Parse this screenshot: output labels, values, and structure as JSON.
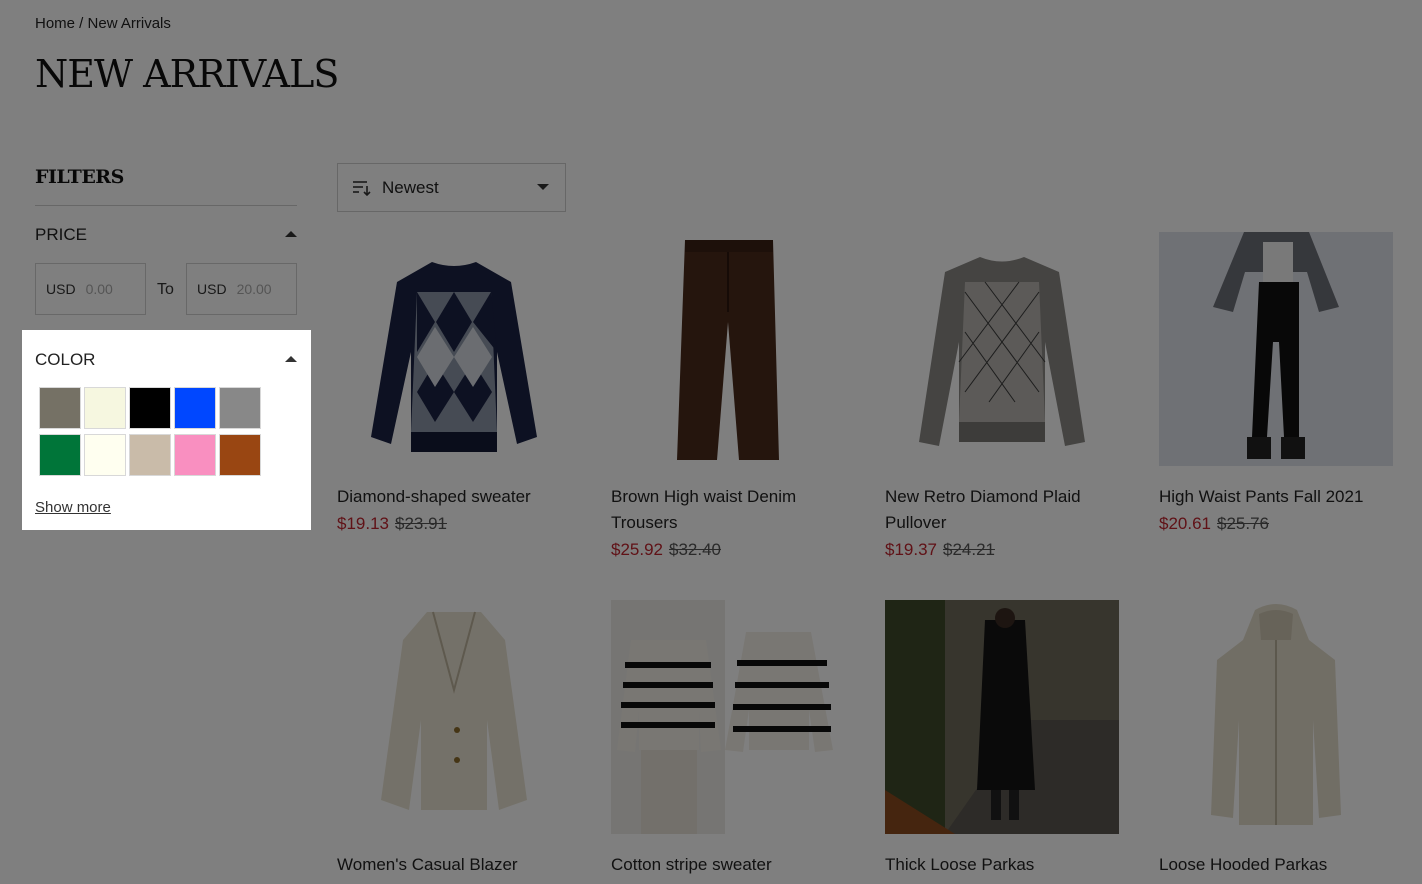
{
  "breadcrumb": {
    "home": "Home",
    "separator": " / ",
    "current": "New Arrivals"
  },
  "page_title": "NEW ARRIVALS",
  "filters": {
    "heading": "FILTERS",
    "price": {
      "title": "PRICE",
      "currency": "USD",
      "min_placeholder": "0.00",
      "max_placeholder": "20.00",
      "to_label": "To"
    },
    "color": {
      "title": "COLOR",
      "swatches": [
        "#757165",
        "#f6f7e0",
        "#000000",
        "#0047ff",
        "#888888",
        "#007539",
        "#fffff0",
        "#c9bba9",
        "#f98fc0",
        "#994612"
      ],
      "show_more": "Show more"
    }
  },
  "sort": {
    "icon": "sort-icon",
    "selected": "Newest"
  },
  "products": [
    {
      "name": "Diamond-shaped sweater",
      "sale": "$19.13",
      "orig": "$23.91",
      "image": "navy-argyle-sweater"
    },
    {
      "name": "Brown High waist Denim Trousers",
      "sale": "$25.92",
      "orig": "$32.40",
      "image": "brown-trousers"
    },
    {
      "name": "New Retro Diamond Plaid Pullover",
      "sale": "$19.37",
      "orig": "$24.21",
      "image": "grey-argyle-sweater"
    },
    {
      "name": "High Waist Pants Fall 2021",
      "sale": "$20.61",
      "orig": "$25.76",
      "image": "model-leather-pants"
    },
    {
      "name": "Women's Casual Blazer",
      "sale": "",
      "orig": "",
      "image": "beige-blazer"
    },
    {
      "name": "Cotton stripe sweater",
      "sale": "",
      "orig": "",
      "image": "striped-sweater"
    },
    {
      "name": "Thick Loose Parkas",
      "sale": "",
      "orig": "",
      "image": "model-black-parka"
    },
    {
      "name": "Loose Hooded Parkas",
      "sale": "",
      "orig": "",
      "image": "beige-hooded-parka"
    }
  ]
}
